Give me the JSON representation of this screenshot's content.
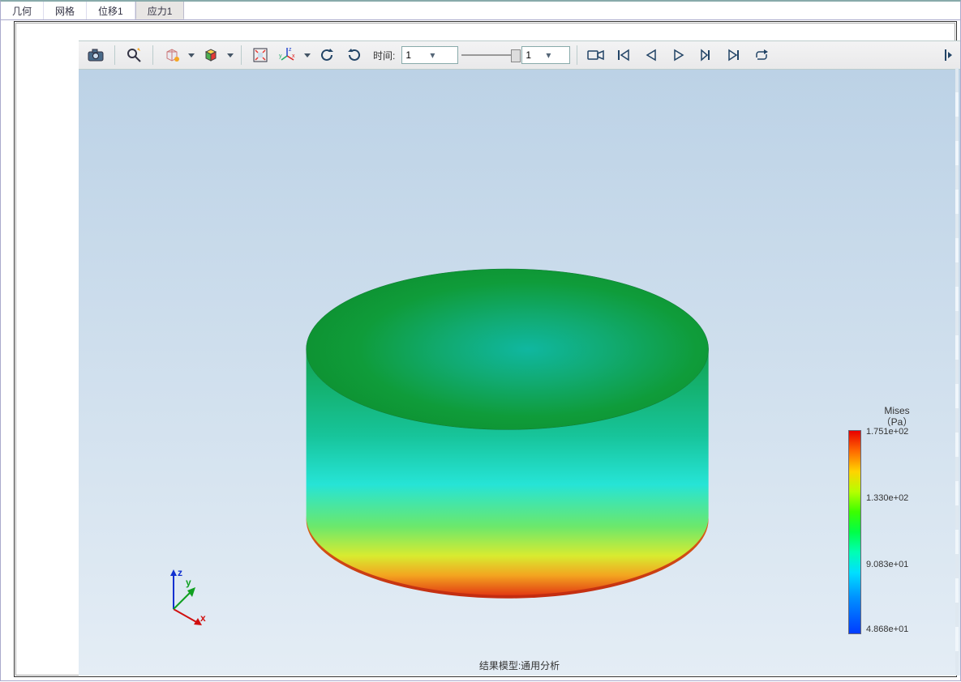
{
  "tabs": {
    "t0": "几何",
    "t1": "网格",
    "t2": "位移1",
    "t3": "应力1"
  },
  "activeTab": 3,
  "toolbar": {
    "time_label": "时间:",
    "time_value": "1",
    "step_value": "1"
  },
  "triad": {
    "x": "x",
    "y": "y",
    "z": "z"
  },
  "caption": "结果模型:通用分析",
  "legend": {
    "title1": "Mises",
    "title2": "（Pa）",
    "v0": "1.751e+02",
    "v1": "1.330e+02",
    "v2": "9.083e+01",
    "v3": "4.868e+01"
  }
}
